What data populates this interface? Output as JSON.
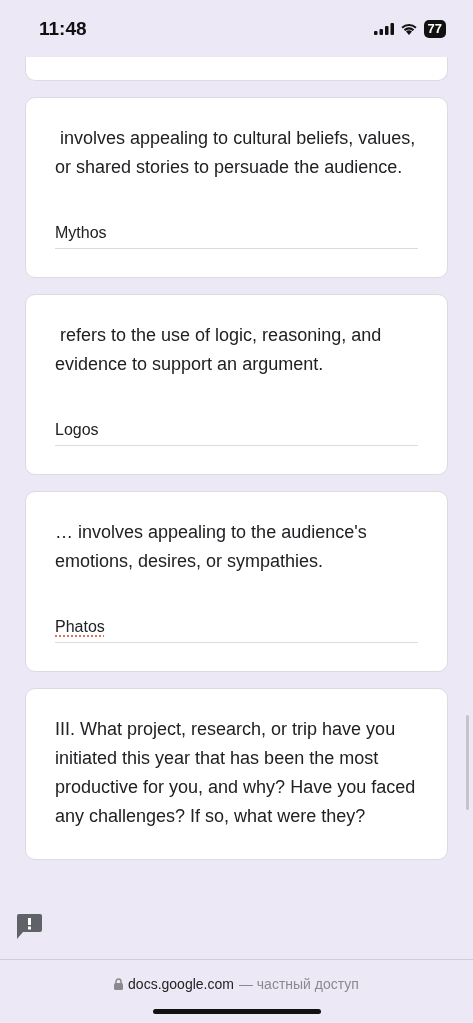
{
  "status_bar": {
    "time": "11:48",
    "battery": "77"
  },
  "questions": [
    {
      "kind": "short_answer",
      "text": " involves appealing to cultural beliefs, values, or shared stories to persuade the audience.",
      "answer": "Mythos",
      "spellcheck_error": false
    },
    {
      "kind": "short_answer",
      "text": " refers to the use of logic, reasoning, and evidence to support an argument.",
      "answer": "Logos",
      "spellcheck_error": false
    },
    {
      "kind": "short_answer",
      "text": "… involves appealing to the audience's emotions, desires, or sympathies.",
      "answer": "Phatos",
      "spellcheck_error": true
    },
    {
      "kind": "open",
      "text": "III. What project, research, or trip have you initiated this year that has been the most productive for you, and why? Have you faced any challenges? If so, what were they?"
    }
  ],
  "address_bar": {
    "domain": "docs.google.com",
    "note": "— частный доступ"
  }
}
